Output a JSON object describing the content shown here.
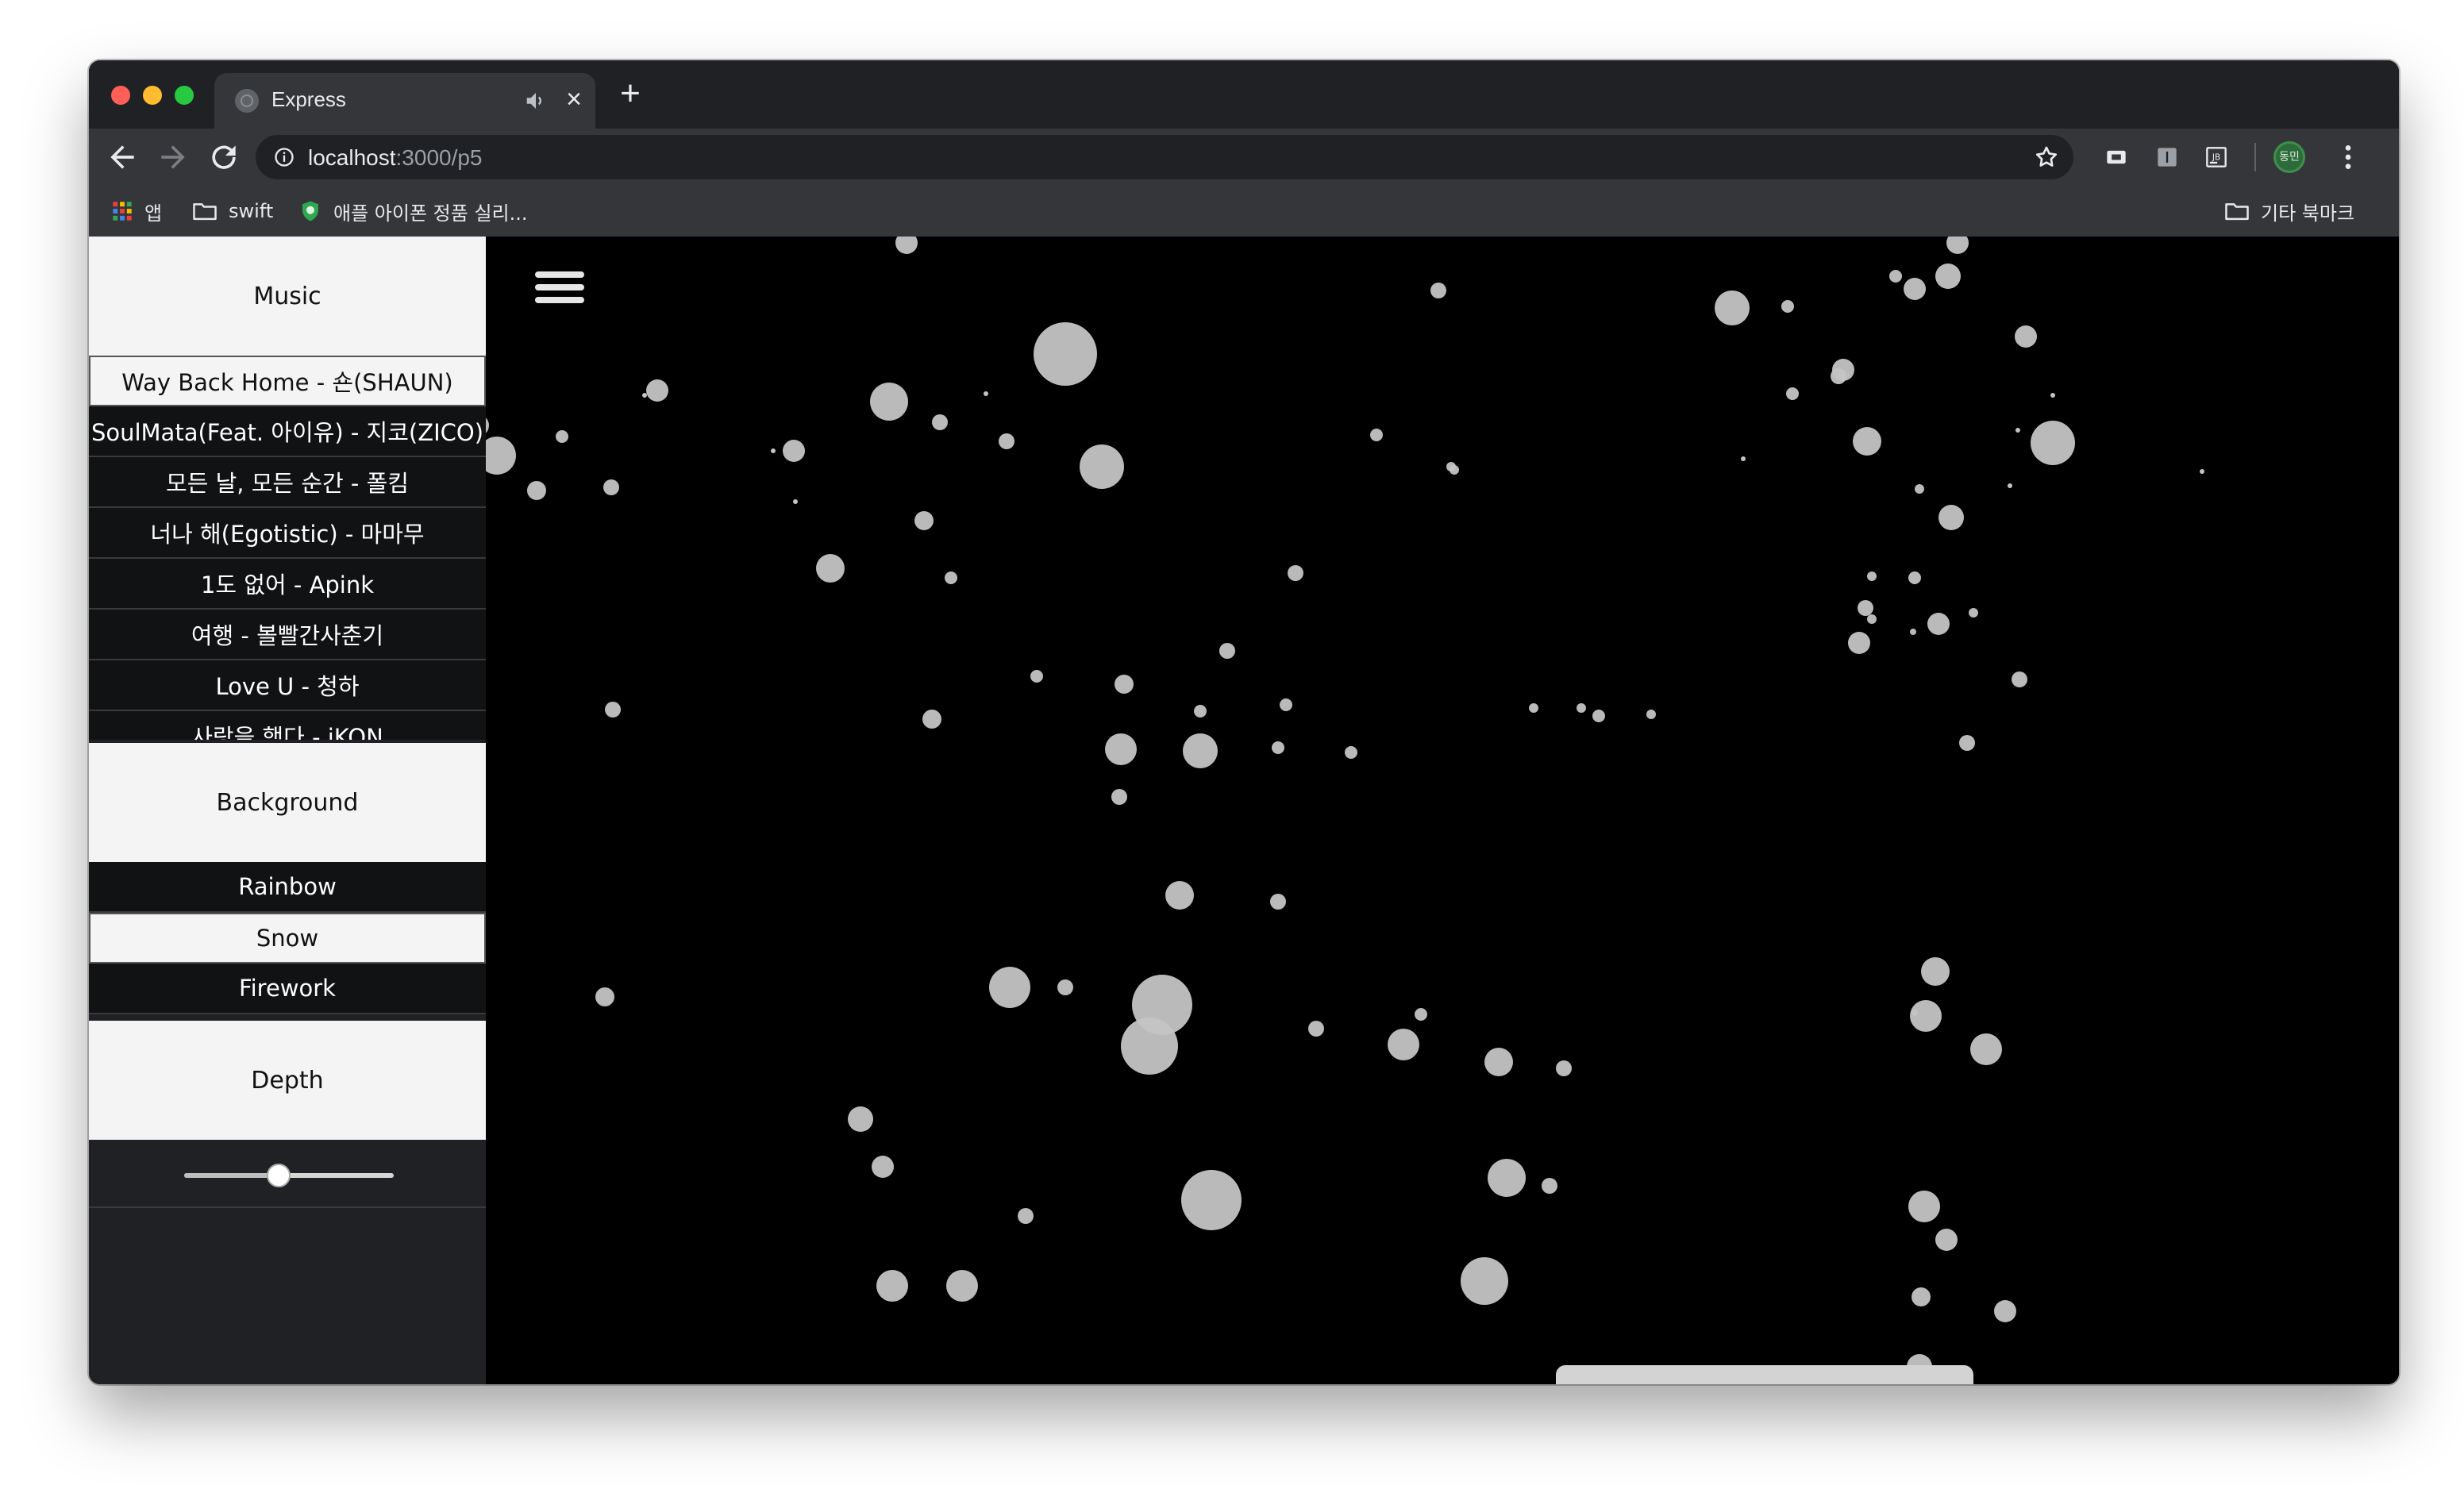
{
  "browser": {
    "tab_title": "Express",
    "url_host": "localhost",
    "url_rest": ":3000/p5",
    "profile_label": "동민",
    "bookmarks": {
      "apps": "앱",
      "swift": "swift",
      "apple": "애플 아이폰 정품 실리...",
      "other": "기타 북마크"
    },
    "extensions": [
      "badge-icon",
      "ibeam-icon",
      "jb-icon"
    ]
  },
  "sidebar": {
    "music_title": "Music",
    "songs": [
      "Way Back Home - 숀(SHAUN)",
      "SoulMata(Feat. 아이유) - 지코(ZICO)",
      "모든 날, 모든 순간 - 폴킴",
      "너나 해(Egotistic) - 마마무",
      "1도 없어 - Apink",
      "여행 - 볼빨간사춘기",
      "Love U - 청하",
      "사랑을 했다 - iKON"
    ],
    "active_song_index": 0,
    "background_title": "Background",
    "backgrounds": [
      "Rainbow",
      "Snow",
      "Firework"
    ],
    "active_background_index": 1,
    "depth_title": "Depth",
    "depth_value": 0.45
  },
  "player": {
    "controls": [
      "rewind",
      "pause",
      "fast-forward"
    ]
  },
  "colors": {
    "page_bg": "#000000",
    "sidebar_bg": "#202124",
    "header_bg": "#f4f4f4",
    "snow": "#c4c4c4",
    "player_bg": "#d3d3d3"
  }
}
